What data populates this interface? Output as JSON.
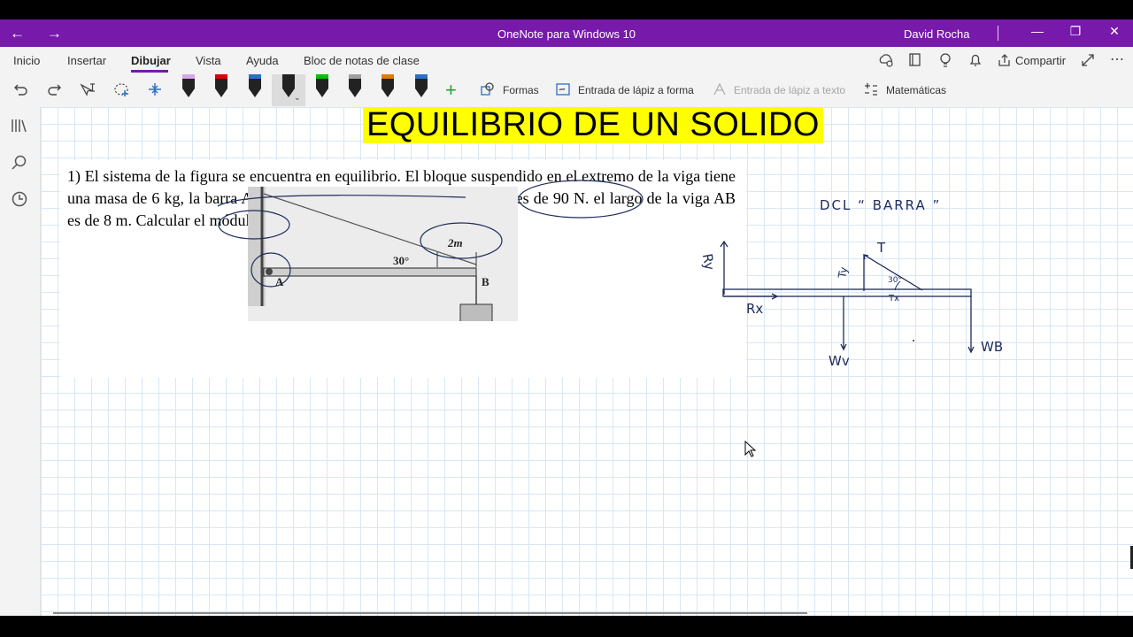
{
  "titlebar": {
    "back_icon": "←",
    "forward_icon": "→",
    "app_title": "OneNote para Windows 10",
    "user": "David Rocha",
    "minimize": "—",
    "restore": "❐",
    "close": "✕",
    "color": "#7719aa"
  },
  "menu": {
    "tabs": [
      "Inicio",
      "Insertar",
      "Dibujar",
      "Vista",
      "Ayuda",
      "Bloc de notas de clase"
    ],
    "active_tab": "Dibujar",
    "share_label": "Compartir"
  },
  "toolbar": {
    "formas": "Formas",
    "ink_to_shape": "Entrada de lápiz a forma",
    "ink_to_text": "Entrada de lápiz a texto",
    "math": "Matemáticas",
    "pens": [
      "#d9a6e8",
      "#e00000",
      "#2a6fc9",
      "#222222",
      "#00c000",
      "#a0a0a0",
      "#e07b00",
      "#2a6fc9"
    ]
  },
  "page": {
    "heading": "EQUILIBRIO DE UN SOLIDO",
    "problem_text": "1) El sistema de la figura se encuentra en equilibrio. El bloque suspendido en el extremo de la viga tiene una masa de 6 kg, la barra AB es homogénea y el tamaño de su peso es de 90 N. el largo de la viga AB es de 8 m. Calcular el módulo de la Tensión de la cuerda.",
    "figure": {
      "angle_label": "30°",
      "point_a": "A",
      "point_b": "B",
      "annotation": "2m"
    },
    "dcl": {
      "title": "DCL  “ BARRA ”",
      "labels": {
        "ry": "Ry",
        "rx": "Rx",
        "t": "T",
        "ty": "Ty",
        "tx": "Tx",
        "angle": "30°",
        "wv": "Wv",
        "wb": "WB"
      }
    }
  }
}
